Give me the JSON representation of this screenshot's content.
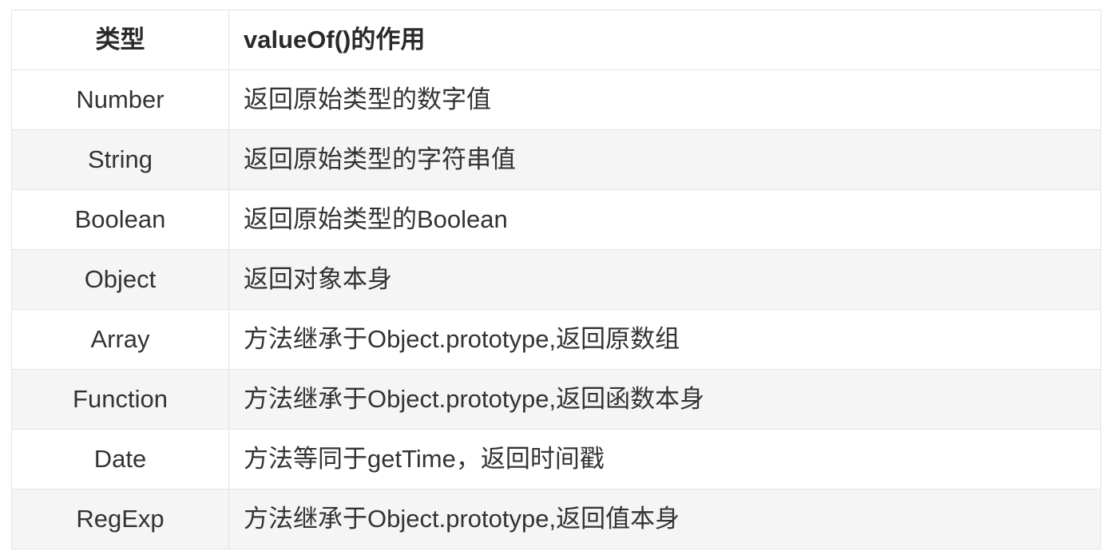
{
  "table": {
    "headers": {
      "type": "类型",
      "desc": "valueOf()的作用"
    },
    "rows": [
      {
        "type": "Number",
        "desc": "返回原始类型的数字值"
      },
      {
        "type": "String",
        "desc": "返回原始类型的字符串值"
      },
      {
        "type": "Boolean",
        "desc": "返回原始类型的Boolean"
      },
      {
        "type": "Object",
        "desc": "返回对象本身"
      },
      {
        "type": "Array",
        "desc": "方法继承于Object.prototype,返回原数组"
      },
      {
        "type": "Function",
        "desc": "方法继承于Object.prototype,返回函数本身"
      },
      {
        "type": "Date",
        "desc": "方法等同于getTime，返回时间戳"
      },
      {
        "type": "RegExp",
        "desc": "方法继承于Object.prototype,返回值本身"
      }
    ]
  }
}
